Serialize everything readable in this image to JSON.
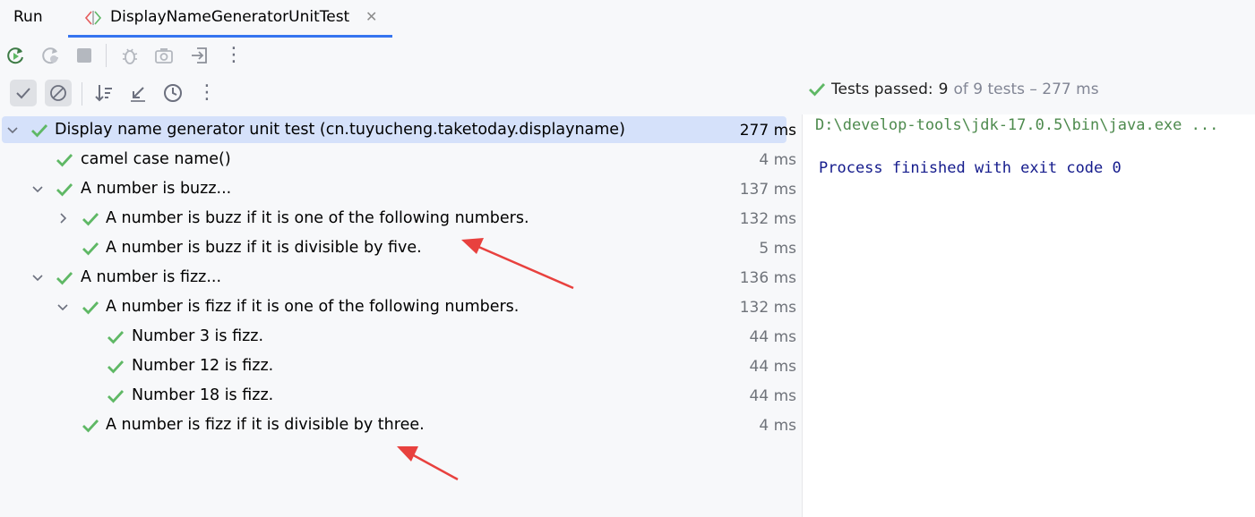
{
  "header": {
    "run_label": "Run",
    "tab_title": "DisplayNameGeneratorUnitTest",
    "close_glyph": "✕"
  },
  "toolbar": {
    "top_icons": [
      "rerun-icon",
      "rerun-failed-icon",
      "stop-icon",
      "debug-icon",
      "screenshot-icon",
      "export-icon",
      "more-icon"
    ],
    "filter_icons": [
      "show-passed-icon",
      "show-ignored-icon",
      "sort-icon",
      "collapse-icon",
      "history-icon",
      "more-icon"
    ]
  },
  "status": {
    "prefix": "Tests passed:",
    "passed": "9",
    "suffix": "of 9 tests – 277 ms"
  },
  "tree": {
    "rows": [
      {
        "label": "Display name generator unit test (cn.tuyucheng.taketoday.displayname)",
        "time": "277 ms"
      },
      {
        "label": "camel case name()",
        "time": "4 ms"
      },
      {
        "label": "A number is buzz...",
        "time": "137 ms"
      },
      {
        "label": "A number is buzz if it is one of the following numbers.",
        "time": "132 ms"
      },
      {
        "label": "A number is buzz if it is divisible by five.",
        "time": "5 ms"
      },
      {
        "label": "A number is fizz...",
        "time": "136 ms"
      },
      {
        "label": "A number is fizz if it is one of the following numbers.",
        "time": "132 ms"
      },
      {
        "label": "Number 3 is fizz.",
        "time": "44 ms"
      },
      {
        "label": "Number 12 is fizz.",
        "time": "44 ms"
      },
      {
        "label": "Number 18 is fizz.",
        "time": "44 ms"
      },
      {
        "label": "A number is fizz if it is divisible by three.",
        "time": "4 ms"
      }
    ]
  },
  "console": {
    "command": "D:\\develop-tools\\jdk-17.0.5\\bin\\java.exe ...",
    "process": "Process finished with exit code 0"
  },
  "colors": {
    "accent": "#3574f0",
    "pass_green": "#5fb865",
    "selection": "#d5e1fa",
    "annotation_red": "#e8413e"
  }
}
